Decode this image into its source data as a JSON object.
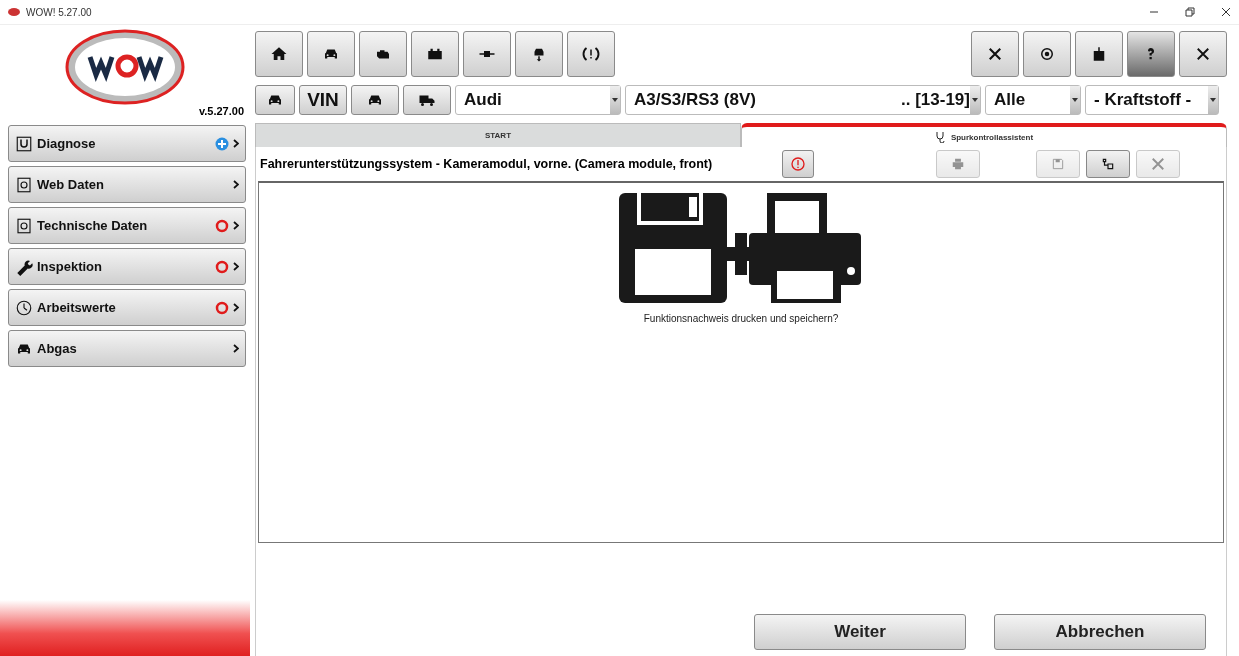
{
  "window": {
    "title": "WOW! 5.27.00"
  },
  "logo": {
    "version": "v.5.27.00"
  },
  "sidebar": {
    "items": [
      {
        "label": "Diagnose",
        "kind": "plus"
      },
      {
        "label": "Web Daten",
        "kind": "plain"
      },
      {
        "label": "Technische Daten",
        "kind": "ring"
      },
      {
        "label": "Inspektion",
        "kind": "ring"
      },
      {
        "label": "Arbeitswerte",
        "kind": "ring"
      },
      {
        "label": "Abgas",
        "kind": "plain"
      }
    ]
  },
  "toolbar": {
    "right": [
      {
        "selected": false
      },
      {
        "selected": false
      },
      {
        "selected": false
      },
      {
        "selected": true
      },
      {
        "selected": false
      }
    ]
  },
  "vehicle_bar": {
    "buttons": [
      {
        "kind": "icon"
      },
      {
        "kind": "text",
        "label": "VIN"
      },
      {
        "kind": "icon"
      },
      {
        "kind": "icon"
      }
    ],
    "make": "Audi",
    "model": "A3/S3/RS3 (8V)",
    "years": ".. [13-19]",
    "variant": "Alle",
    "fuel": "- Kraftstoff -"
  },
  "tabs": [
    {
      "label": "START",
      "selected": false
    },
    {
      "label": "Spurkontrollassistent",
      "selected": true
    }
  ],
  "panel": {
    "title": "Fahrerunterstützungssystem - Kameramodul, vorne. (Camera module, front)",
    "actions": [
      {
        "disabled": false
      },
      {
        "disabled": true
      },
      {
        "disabled": true
      },
      {
        "disabled": false
      },
      {
        "disabled": true
      }
    ],
    "question": "Funktionsnachweis drucken und speichern?"
  },
  "buttons": [
    "Weiter",
    "Abbrechen"
  ]
}
